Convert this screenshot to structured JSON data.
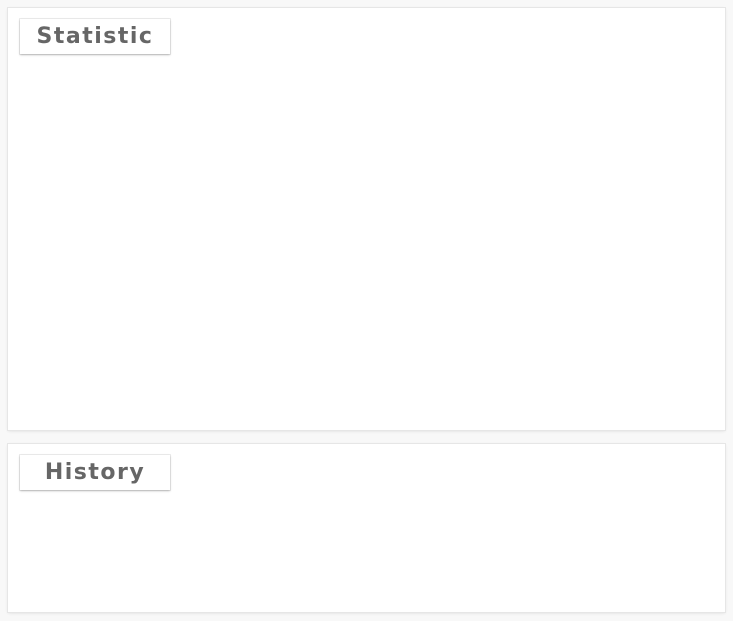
{
  "panels": {
    "statistic": {
      "title": "Statistic"
    },
    "history": {
      "title": "History"
    }
  }
}
